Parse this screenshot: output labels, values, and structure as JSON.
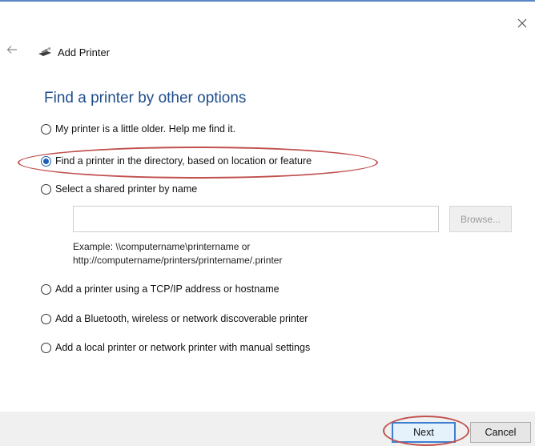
{
  "window": {
    "title": "Add Printer",
    "close_icon": "close-icon",
    "back_icon": "back-arrow-icon",
    "app_icon": "printer-icon"
  },
  "main": {
    "heading": "Find a printer by other options",
    "options": [
      {
        "label": "My printer is a little older. Help me find it.",
        "checked": false
      },
      {
        "label": "Find a printer in the directory, based on location or feature",
        "checked": true
      },
      {
        "label": "Select a shared printer by name",
        "checked": false
      },
      {
        "label": "Add a printer using a TCP/IP address or hostname",
        "checked": false
      },
      {
        "label": "Add a Bluetooth, wireless or network discoverable printer",
        "checked": false
      },
      {
        "label": "Add a local printer or network printer with manual settings",
        "checked": false
      }
    ],
    "shared_printer": {
      "value": "",
      "browse_label": "Browse...",
      "example_line1": "Example: \\\\computername\\printername or",
      "example_line2": "http://computername/printers/printername/.printer"
    }
  },
  "footer": {
    "next_label": "Next",
    "cancel_label": "Cancel"
  },
  "colors": {
    "accent": "#1a5fb4",
    "heading": "#1f4e8c",
    "annotation": "#c0504d"
  }
}
